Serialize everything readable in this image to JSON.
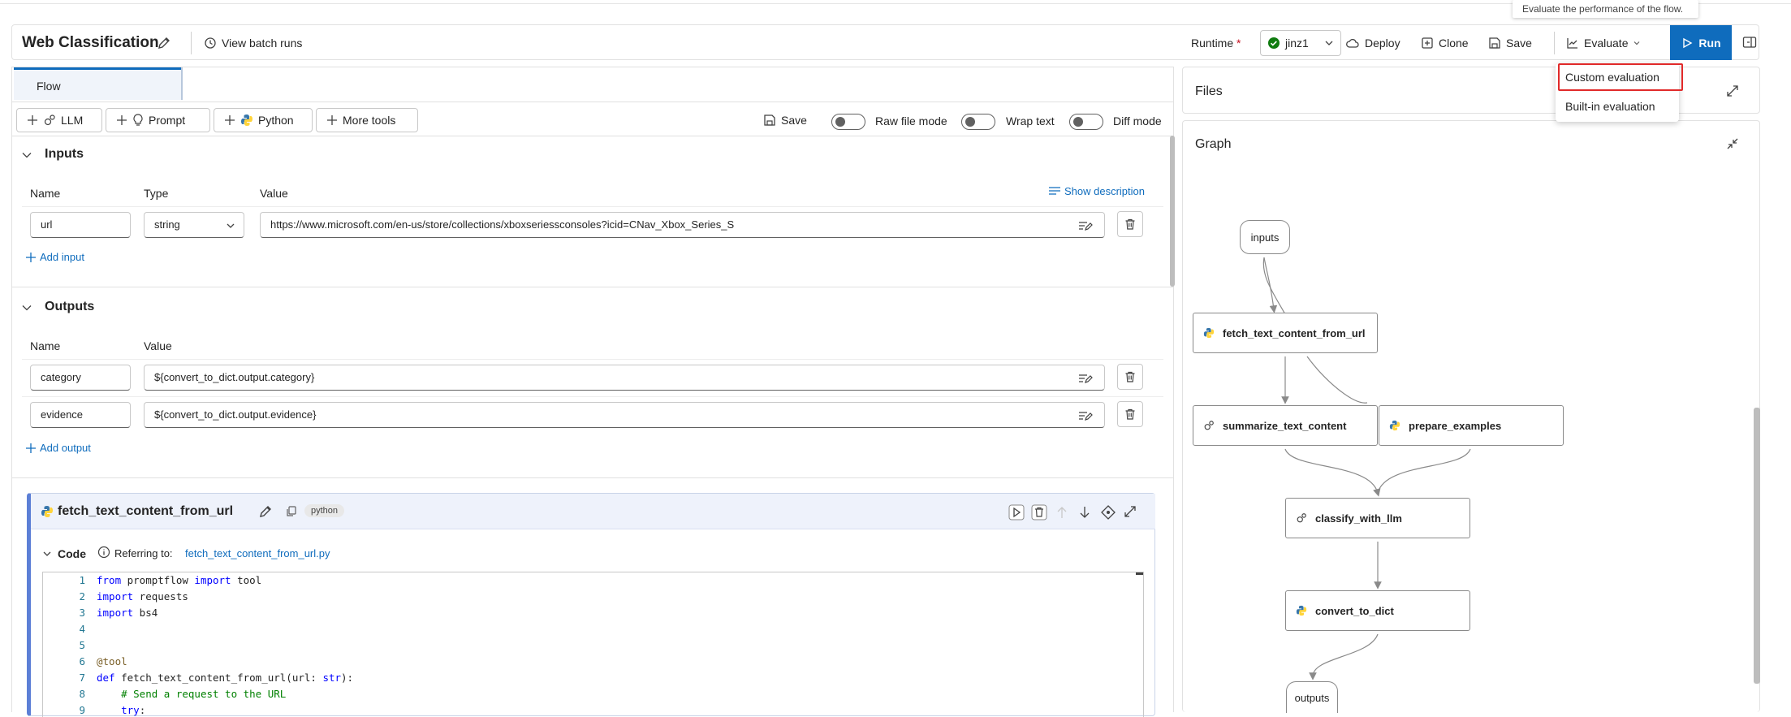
{
  "tooltip": "Evaluate the performance of the flow.",
  "header": {
    "title": "Web Classification",
    "view_batch_runs": "View batch runs",
    "runtime_label": "Runtime",
    "runtime_required": "*",
    "runtime_value": "jinz1",
    "deploy": "Deploy",
    "clone": "Clone",
    "save": "Save",
    "evaluate": "Evaluate",
    "run": "Run"
  },
  "evaluate_menu": {
    "items": [
      "Custom evaluation",
      "Built-in evaluation"
    ],
    "highlight_color": "#e12a2a"
  },
  "tabs": [
    "Flow"
  ],
  "toolbar": {
    "llm": "LLM",
    "prompt": "Prompt",
    "python": "Python",
    "more_tools": "More tools",
    "save": "Save",
    "raw_file_mode": "Raw file mode",
    "wrap_text": "Wrap text",
    "diff_mode": "Diff mode"
  },
  "inputs": {
    "title": "Inputs",
    "col_name": "Name",
    "col_type": "Type",
    "col_value": "Value",
    "show_description": "Show description",
    "rows": [
      {
        "name": "url",
        "type": "string",
        "value": "https://www.microsoft.com/en-us/store/collections/xboxseriessconsoles?icid=CNav_Xbox_Series_S"
      }
    ],
    "add": "Add input"
  },
  "outputs": {
    "title": "Outputs",
    "col_name": "Name",
    "col_value": "Value",
    "rows": [
      {
        "name": "category",
        "value": "${convert_to_dict.output.category}"
      },
      {
        "name": "evidence",
        "value": "${convert_to_dict.output.evidence}"
      }
    ],
    "add": "Add output"
  },
  "node": {
    "name": "fetch_text_content_from_url",
    "badge": "python",
    "code_label": "Code",
    "referring_to": "Referring to:",
    "file": "fetch_text_content_from_url.py",
    "line_numbers": [
      "1",
      "2",
      "3",
      "4",
      "5",
      "6",
      "7",
      "8",
      "9"
    ]
  },
  "right": {
    "files_title": "Files",
    "graph_title": "Graph"
  },
  "graph": {
    "inputs": "inputs",
    "outputs": "outputs",
    "nodes": [
      "fetch_text_content_from_url",
      "summarize_text_content",
      "prepare_examples",
      "classify_with_llm",
      "convert_to_dict"
    ]
  },
  "colors": {
    "accent": "#0f6cbd",
    "runtime_ok": "#107c10",
    "python_blue": "#3776ab",
    "python_yellow": "#ffd43b"
  }
}
